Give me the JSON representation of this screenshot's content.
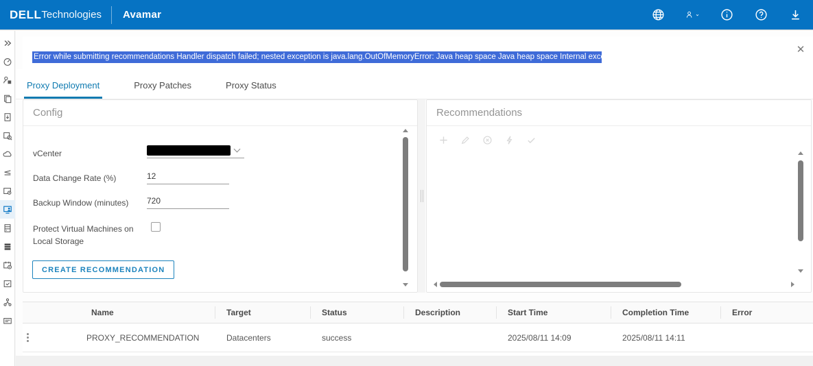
{
  "colors": {
    "header_blue": "#0673c3",
    "accent_blue": "#1c83bd",
    "active_tab_blue": "#0e7ab0",
    "selection_blue": "#3f6bd8",
    "sidebar_active_blue": "#0673c3",
    "scrollbar_gray": "#7d7d7d"
  },
  "header": {
    "brand_bold": "DELL",
    "brand_rest": "Technologies",
    "app_title": "Avamar",
    "icons": [
      "globe-icon",
      "user-menu-icon",
      "info-icon",
      "help-icon",
      "download-icon"
    ]
  },
  "sidebar": {
    "items": [
      "expand-icon",
      "dashboard-icon",
      "asset-config-icon",
      "copies-icon",
      "restore-icon",
      "instant-access-icon",
      "cloud-icon",
      "queue-icon",
      "settings-box-icon",
      "proxy-management-icon",
      "system-icon",
      "server-icon",
      "schedule-icon",
      "tasks-icon",
      "topology-icon",
      "events-icon"
    ],
    "active_item": "proxy-management-icon"
  },
  "alert": {
    "message": "Error while submitting recommendations Handler dispatch failed; nested exception is java.lang.OutOfMemoryError: Java heap space Java heap space Internal exception.",
    "close_icon": "close-icon"
  },
  "tabs": {
    "items": [
      {
        "label": "Proxy Deployment",
        "active": true
      },
      {
        "label": "Proxy Patches",
        "active": false
      },
      {
        "label": "Proxy Status",
        "active": false
      }
    ]
  },
  "config": {
    "title": "Config",
    "vcenter_label": "vCenter",
    "vcenter_value_redacted": true,
    "data_change_rate_label": "Data Change Rate (%)",
    "data_change_rate_value": "12",
    "backup_window_label": "Backup Window (minutes)",
    "backup_window_value": "720",
    "protect_label_line1": "Protect Virtual Machines on",
    "protect_label_line2": "Local Storage",
    "protect_checked": false,
    "create_button_label": "CREATE RECOMMENDATION"
  },
  "recommendations": {
    "title": "Recommendations",
    "toolbar_icons": [
      "add-icon",
      "edit-icon",
      "cancel-icon",
      "run-icon",
      "accept-icon"
    ],
    "toolbar_disabled": true
  },
  "jobs_table": {
    "columns": [
      "Name",
      "Target",
      "Status",
      "Description",
      "Start Time",
      "Completion Time",
      "Error"
    ],
    "rows": [
      {
        "name": "PROXY_RECOMMENDATION",
        "target": "Datacenters",
        "status": "success",
        "description": "",
        "start_time": "2025/08/11 14:09",
        "completion_time": "2025/08/11 14:11",
        "error": ""
      }
    ]
  }
}
